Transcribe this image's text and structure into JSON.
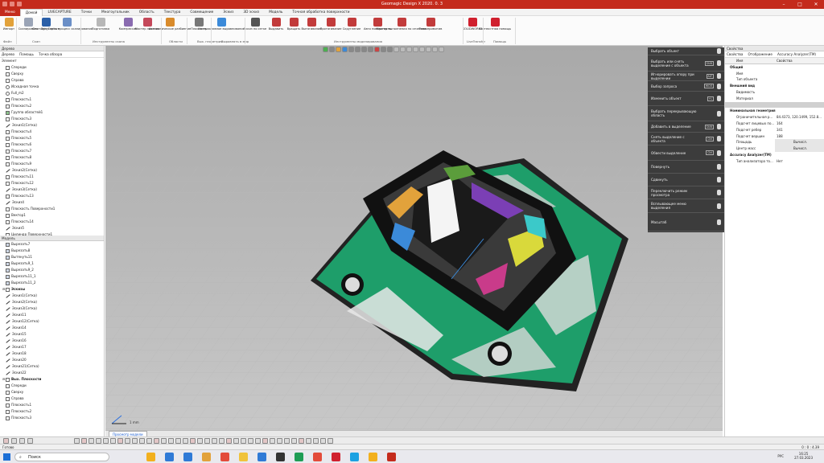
{
  "app": {
    "title": "Geomagic Design X 2020. 0. 3",
    "accent": "#c42b1c"
  },
  "tabs": [
    "Меню",
    "Домой",
    "LIVECAPTURE",
    "Точки",
    "Многоугольник",
    "Область",
    "Текстура",
    "Совмещение",
    "Эскиз",
    "3D эскиз",
    "Модель",
    "Точная обработка поверхности"
  ],
  "ribbon": {
    "buttons": [
      {
        "label": "Импорт",
        "icon": "import-icon",
        "color": "#e2a23b"
      },
      {
        "label": "Сканировать",
        "icon": "scan-icon",
        "color": "#9aa4b6"
      },
      {
        "label": "Geomagic Capture",
        "icon": "capture-icon",
        "color": "#2a5fa8"
      },
      {
        "label": "Запустить процесс сканирования",
        "icon": "scan-process-icon",
        "color": "#6b8fc7"
      },
      {
        "label": "Подготовка",
        "icon": "prepare-icon",
        "color": "#b7b7b7"
      },
      {
        "label": "Компрессия",
        "icon": "compress-icon",
        "color": "#8a6bb0"
      },
      {
        "label": "Мастер лечения",
        "icon": "heal-icon",
        "color": "#c4485a"
      },
      {
        "label": "Автоматическое разбиение",
        "icon": "auto-segment-icon",
        "color": "#d98b2b"
      },
      {
        "label": "Плоскость",
        "icon": "plane-icon",
        "color": "#777777"
      },
      {
        "label": "Интерактивное выравнивание",
        "icon": "align-icon",
        "color": "#3b8ad9"
      },
      {
        "label": "Эскиз по сетке",
        "icon": "mesh-sketch-icon",
        "color": "#555555"
      },
      {
        "label": "Выдавить",
        "icon": "extrude-icon",
        "color": "#c23b3b"
      },
      {
        "label": "Вращать",
        "icon": "revolve-icon",
        "color": "#c23b3b"
      },
      {
        "label": "Вытягивание",
        "icon": "sweep-icon",
        "color": "#c23b3b"
      },
      {
        "label": "Протягивание",
        "icon": "loft-icon",
        "color": "#c23b3b"
      },
      {
        "label": "Скругление",
        "icon": "fillet-icon",
        "color": "#c23b3b"
      },
      {
        "label": "Авто поверхность",
        "icon": "auto-surface-icon",
        "color": "#c23b3b"
      },
      {
        "label": "Мастер выполнения по сечениям",
        "icon": "section-wizard-icon",
        "color": "#c23b3b"
      },
      {
        "label": "Тело-примитив",
        "icon": "primitive-icon",
        "color": "#c23b3b"
      },
      {
        "label": "SOLIDWORKS",
        "icon": "solidworks-icon",
        "color": "#d0202e"
      },
      {
        "label": "Контекстная помощь",
        "icon": "help-icon",
        "color": "#d0202e"
      }
    ],
    "groups": [
      "Файл",
      "Скан",
      "Инструменты скана",
      "Области",
      "Вых. геометрия",
      "Выровнять в мир",
      "Инструменты моделирования",
      "LiveTransfer",
      "Помощь"
    ]
  },
  "left_panel": {
    "title": "Дерево",
    "tabs": [
      "Дерево",
      "Помощь",
      "Точка обзора"
    ],
    "section": "Элемент",
    "features": [
      {
        "label": "Спереди",
        "kind": "plane"
      },
      {
        "label": "Сверху",
        "kind": "plane"
      },
      {
        "label": "Справа",
        "kind": "plane"
      },
      {
        "label": "Исходная точка",
        "kind": "point"
      },
      {
        "label": "Full_m2",
        "kind": "mesh"
      },
      {
        "label": "Плоскость1",
        "kind": "plane"
      },
      {
        "label": "Плоскость2",
        "kind": "plane"
      },
      {
        "label": "Группа областей1",
        "kind": "group"
      },
      {
        "label": "Плоскость3",
        "kind": "plane"
      },
      {
        "label": "Эскиз1(Сетка)",
        "kind": "sketch"
      },
      {
        "label": "Плоскость4",
        "kind": "plane"
      },
      {
        "label": "Плоскость5",
        "kind": "plane"
      },
      {
        "label": "Плоскость6",
        "kind": "plane"
      },
      {
        "label": "Плоскость7",
        "kind": "plane"
      },
      {
        "label": "Плоскость8",
        "kind": "plane"
      },
      {
        "label": "Плоскость9",
        "kind": "plane"
      },
      {
        "label": "Эскиз2(Сетка)",
        "kind": "sketch"
      },
      {
        "label": "Плоскость11",
        "kind": "plane"
      },
      {
        "label": "Плоскость12",
        "kind": "plane"
      },
      {
        "label": "Эскиз3(Сетка)",
        "kind": "sketch"
      },
      {
        "label": "Плоскость13",
        "kind": "plane"
      },
      {
        "label": "Эскиз4",
        "kind": "sketch"
      },
      {
        "label": "Плоскость Поверхности1",
        "kind": "plane"
      },
      {
        "label": "Вектор1",
        "kind": "plane"
      },
      {
        "label": "Плоскость14",
        "kind": "plane"
      },
      {
        "label": "Эскиз5",
        "kind": "sketch"
      },
      {
        "label": "Цилиндр Поверхности1",
        "kind": "plane"
      },
      {
        "label": "Вектор2",
        "kind": "plane"
      }
    ],
    "model_title": "Модель",
    "model_items": [
      {
        "label": "Вырезать7",
        "kind": "body",
        "bold": false
      },
      {
        "label": "Вырезать8",
        "kind": "body",
        "bold": false
      },
      {
        "label": "Вытянуть11",
        "kind": "body",
        "bold": false
      },
      {
        "label": "Вырезать9_1",
        "kind": "body",
        "bold": false
      },
      {
        "label": "Вырезать9_2",
        "kind": "body",
        "bold": false
      },
      {
        "label": "Вырезать11_1",
        "kind": "body",
        "bold": false
      },
      {
        "label": "Вырезать11_2",
        "kind": "body",
        "bold": false
      },
      {
        "label": "Эскизы",
        "kind": "folder",
        "bold": true
      },
      {
        "label": "Эскиз1(Сетка)",
        "kind": "sketch",
        "bold": false
      },
      {
        "label": "Эскиз2(Сетка)",
        "kind": "sketch",
        "bold": false
      },
      {
        "label": "Эскиз3(Сетка)",
        "kind": "sketch",
        "bold": false
      },
      {
        "label": "Эскиз11",
        "kind": "sketch",
        "bold": false
      },
      {
        "label": "Эскиз12(Сетка)",
        "kind": "sketch",
        "bold": false
      },
      {
        "label": "Эскиз14",
        "kind": "sketch",
        "bold": false
      },
      {
        "label": "Эскиз15",
        "kind": "sketch",
        "bold": false
      },
      {
        "label": "Эскиз16",
        "kind": "sketch",
        "bold": false
      },
      {
        "label": "Эскиз17",
        "kind": "sketch",
        "bold": false
      },
      {
        "label": "Эскиз18",
        "kind": "sketch",
        "bold": false
      },
      {
        "label": "Эскиз20",
        "kind": "sketch",
        "bold": false
      },
      {
        "label": "Эскиз21(Сетка)",
        "kind": "sketch",
        "bold": false
      },
      {
        "label": "Эскиз22",
        "kind": "sketch",
        "bold": false
      },
      {
        "label": "Вых. Плоскости",
        "kind": "folder",
        "bold": true
      },
      {
        "label": "Спереди",
        "kind": "plane",
        "bold": false
      },
      {
        "label": "Сверху",
        "kind": "plane",
        "bold": false
      },
      {
        "label": "Справа",
        "kind": "plane",
        "bold": false
      },
      {
        "label": "Плоскость1",
        "kind": "plane",
        "bold": false
      },
      {
        "label": "Плоскость2",
        "kind": "plane",
        "bold": false
      },
      {
        "label": "Плоскость3",
        "kind": "plane",
        "bold": false
      }
    ]
  },
  "context_menu": [
    {
      "label": "Выбрать объект",
      "key": ""
    },
    {
      "label": "Выбрать или снять выделение с объекта",
      "key": "Shift"
    },
    {
      "label": "Игнорировать опору при выделении",
      "key": "ALT"
    },
    {
      "label": "Выбор запроса",
      "key": "ЖОЛ"
    },
    {
      "label": "Изменить объект",
      "key": "+L"
    },
    {
      "label": "Выбрать перекрывающую область",
      "key": ""
    },
    {
      "label": "Добавить в выделение",
      "key": "Shift"
    },
    {
      "label": "Снять выделение с объекта",
      "key": "Ctrl"
    },
    {
      "label": "Обвести выделение",
      "key": "Ctrl"
    },
    {
      "label": "Повернуть",
      "key": ""
    },
    {
      "label": "Сдвинуть",
      "key": ""
    },
    {
      "label": "Переключить режим просмотра",
      "key": ""
    },
    {
      "label": "Всплывающее меню выделения",
      "key": ""
    },
    {
      "label": "Масштаб",
      "key": ""
    }
  ],
  "right_panel": {
    "title": "Свойства",
    "tabs": [
      "Свойства",
      "Отображение",
      "Accuracy Analyzer(TM)"
    ],
    "col_name": "Имя",
    "col_value": "Свойства",
    "rows": [
      {
        "type": "sec",
        "name": "Общий"
      },
      {
        "type": "row",
        "name": "Имя",
        "value": ""
      },
      {
        "type": "row",
        "name": "Тип объекта",
        "value": ""
      },
      {
        "type": "sec",
        "name": "Внешний вид"
      },
      {
        "type": "row",
        "name": "Видимость",
        "value": ""
      },
      {
        "type": "row",
        "name": "Материал",
        "value": ""
      },
      {
        "type": "blank",
        "name": "",
        "value": ""
      },
      {
        "type": "sec",
        "name": "Номинальная геометрия"
      },
      {
        "type": "row",
        "name": "Ограничительная р...",
        "value": "84.4373, 120.1499, 152.8..."
      },
      {
        "type": "row",
        "name": "Подсчет лицевых по...",
        "value": "164"
      },
      {
        "type": "row",
        "name": "Подсчет ребер",
        "value": "341"
      },
      {
        "type": "row",
        "name": "Подсчет вершин",
        "value": "188"
      },
      {
        "type": "row",
        "name": "Площадь",
        "value": "Вычисл."
      },
      {
        "type": "row",
        "name": "Центр масс",
        "value": "Вычисл."
      },
      {
        "type": "sec",
        "name": "Accuracy Analyzer(TM)"
      },
      {
        "type": "row",
        "name": "Тип анализатора то...",
        "value": "Нет"
      }
    ]
  },
  "viewport": {
    "tab": "Просмотр модели",
    "scale": "1 mm"
  },
  "status": {
    "left": "Готово",
    "right": "0 : 0 : 4.39"
  },
  "taskbar": {
    "search": "Поиск",
    "lang": "РУС",
    "time": "16:25",
    "date": "27.03.2023",
    "apps": [
      "#f2b01e",
      "#2f7ad6",
      "#2f7ad6",
      "#e2a23b",
      "#e34b3b",
      "#f0c33c",
      "#2f7ad6",
      "#333333",
      "#1f9d55",
      "#e34b3b",
      "#d0202e",
      "#1ba1e2",
      "#f2b01e",
      "#c42b1c"
    ]
  }
}
